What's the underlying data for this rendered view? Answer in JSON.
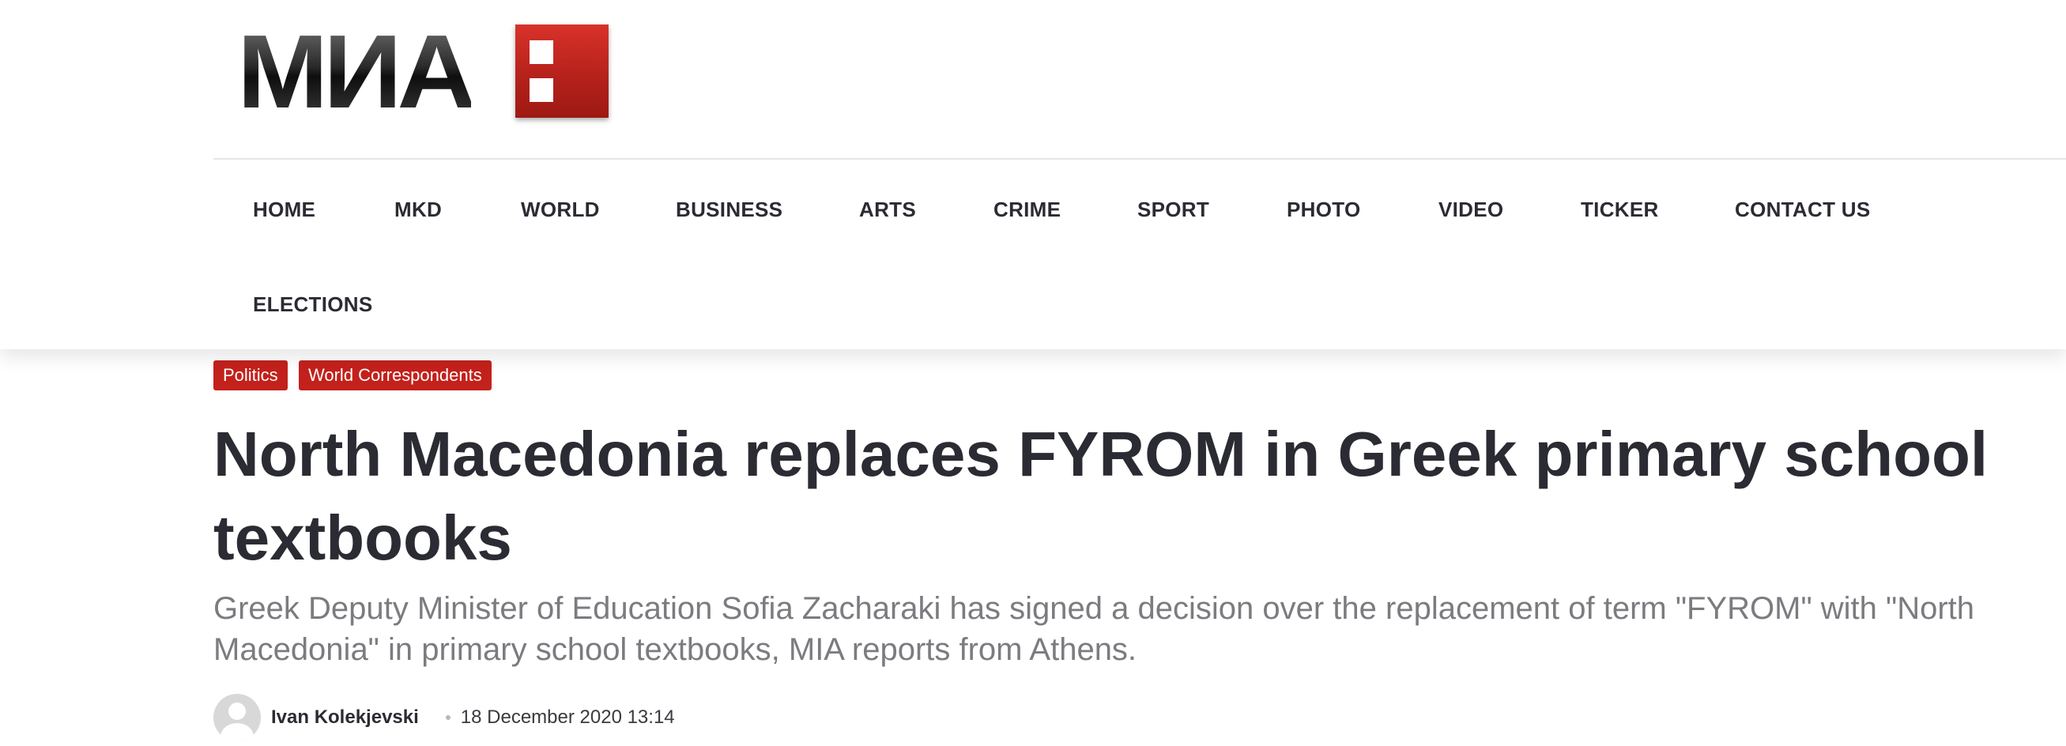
{
  "brand": {
    "logo_text": "МИА",
    "logo_color": "#c3211c"
  },
  "nav": {
    "items": [
      {
        "label": "HOME"
      },
      {
        "label": "MKD"
      },
      {
        "label": "WORLD"
      },
      {
        "label": "BUSINESS"
      },
      {
        "label": "ARTS"
      },
      {
        "label": "CRIME"
      },
      {
        "label": "SPORT"
      },
      {
        "label": "PHOTO"
      },
      {
        "label": "VIDEO"
      },
      {
        "label": "TICKER"
      },
      {
        "label": "CONTACT US"
      },
      {
        "label": "ELECTIONS"
      }
    ]
  },
  "article": {
    "tags": [
      {
        "label": "Politics"
      },
      {
        "label": "World Correspondents"
      }
    ],
    "title": "North Macedonia replaces FYROM in Greek primary school textbooks",
    "lede": "Greek Deputy Minister of Education Sofia Zacharaki has signed a decision over the replacement of term \"FYROM\" with \"North Macedonia\" in primary school textbooks, MIA reports from Athens.",
    "author": "Ivan Kolekjevski",
    "date": "18 December 2020 13:14",
    "avatar_icon": "user-avatar-icon"
  },
  "colors": {
    "accent": "#c3211c",
    "text": "#2b2b33",
    "muted": "#7b7b80"
  }
}
